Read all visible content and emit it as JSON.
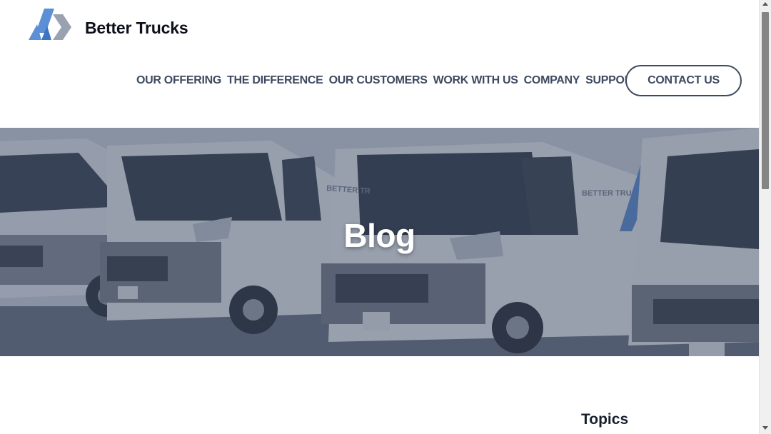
{
  "header": {
    "brand": "Better Trucks",
    "logo_icon": "better-trucks-logo",
    "nav": [
      {
        "label": "OUR OFFERING"
      },
      {
        "label": "THE DIFFERENCE"
      },
      {
        "label": "OUR CUSTOMERS"
      },
      {
        "label": "WORK WITH US"
      },
      {
        "label": "COMPANY"
      },
      {
        "label": "SUPPORT"
      }
    ],
    "contact_label": "CONTACT US"
  },
  "hero": {
    "title": "Blog",
    "van_lettering": [
      "BETTER TR",
      "BETTER TRUC"
    ]
  },
  "sidebar": {
    "topics_heading": "Topics"
  },
  "colors": {
    "nav_text": "#3e4a61",
    "brand_text": "#0d0f1a",
    "logo_blue": "#5b8fd6",
    "logo_gray": "#9aa2b1",
    "hero_overlay": "#34425e"
  }
}
